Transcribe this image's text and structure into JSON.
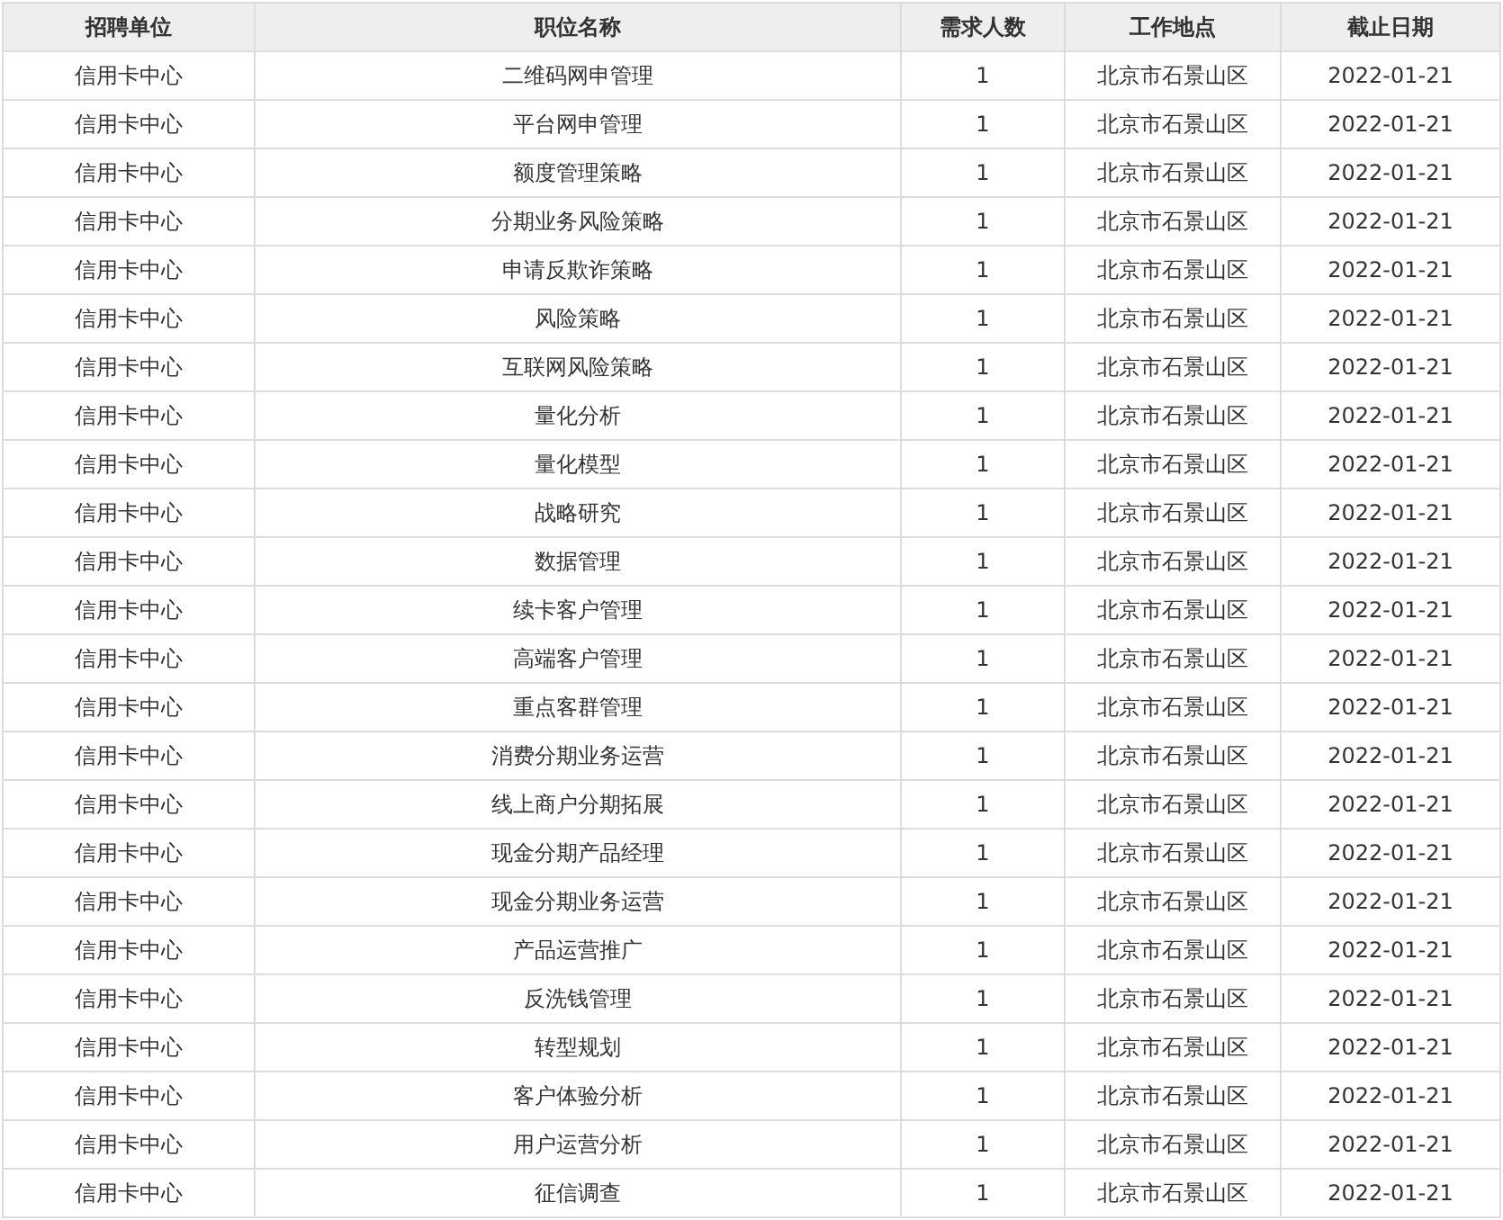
{
  "table": {
    "columns": [
      "招聘单位",
      "职位名称",
      "需求人数",
      "工作地点",
      "截止日期"
    ],
    "rows": [
      [
        "信用卡中心",
        "二维码网申管理",
        "1",
        "北京市石景山区",
        "2022-01-21"
      ],
      [
        "信用卡中心",
        "平台网申管理",
        "1",
        "北京市石景山区",
        "2022-01-21"
      ],
      [
        "信用卡中心",
        "额度管理策略",
        "1",
        "北京市石景山区",
        "2022-01-21"
      ],
      [
        "信用卡中心",
        "分期业务风险策略",
        "1",
        "北京市石景山区",
        "2022-01-21"
      ],
      [
        "信用卡中心",
        "申请反欺诈策略",
        "1",
        "北京市石景山区",
        "2022-01-21"
      ],
      [
        "信用卡中心",
        "风险策略",
        "1",
        "北京市石景山区",
        "2022-01-21"
      ],
      [
        "信用卡中心",
        "互联网风险策略",
        "1",
        "北京市石景山区",
        "2022-01-21"
      ],
      [
        "信用卡中心",
        "量化分析",
        "1",
        "北京市石景山区",
        "2022-01-21"
      ],
      [
        "信用卡中心",
        "量化模型",
        "1",
        "北京市石景山区",
        "2022-01-21"
      ],
      [
        "信用卡中心",
        "战略研究",
        "1",
        "北京市石景山区",
        "2022-01-21"
      ],
      [
        "信用卡中心",
        "数据管理",
        "1",
        "北京市石景山区",
        "2022-01-21"
      ],
      [
        "信用卡中心",
        "续卡客户管理",
        "1",
        "北京市石景山区",
        "2022-01-21"
      ],
      [
        "信用卡中心",
        "高端客户管理",
        "1",
        "北京市石景山区",
        "2022-01-21"
      ],
      [
        "信用卡中心",
        "重点客群管理",
        "1",
        "北京市石景山区",
        "2022-01-21"
      ],
      [
        "信用卡中心",
        "消费分期业务运营",
        "1",
        "北京市石景山区",
        "2022-01-21"
      ],
      [
        "信用卡中心",
        "线上商户分期拓展",
        "1",
        "北京市石景山区",
        "2022-01-21"
      ],
      [
        "信用卡中心",
        "现金分期产品经理",
        "1",
        "北京市石景山区",
        "2022-01-21"
      ],
      [
        "信用卡中心",
        "现金分期业务运营",
        "1",
        "北京市石景山区",
        "2022-01-21"
      ],
      [
        "信用卡中心",
        "产品运营推广",
        "1",
        "北京市石景山区",
        "2022-01-21"
      ],
      [
        "信用卡中心",
        "反洗钱管理",
        "1",
        "北京市石景山区",
        "2022-01-21"
      ],
      [
        "信用卡中心",
        "转型规划",
        "1",
        "北京市石景山区",
        "2022-01-21"
      ],
      [
        "信用卡中心",
        "客户体验分析",
        "1",
        "北京市石景山区",
        "2022-01-21"
      ],
      [
        "信用卡中心",
        "用户运营分析",
        "1",
        "北京市石景山区",
        "2022-01-21"
      ],
      [
        "信用卡中心",
        "征信调查",
        "1",
        "北京市石景山区",
        "2022-01-21"
      ]
    ]
  }
}
